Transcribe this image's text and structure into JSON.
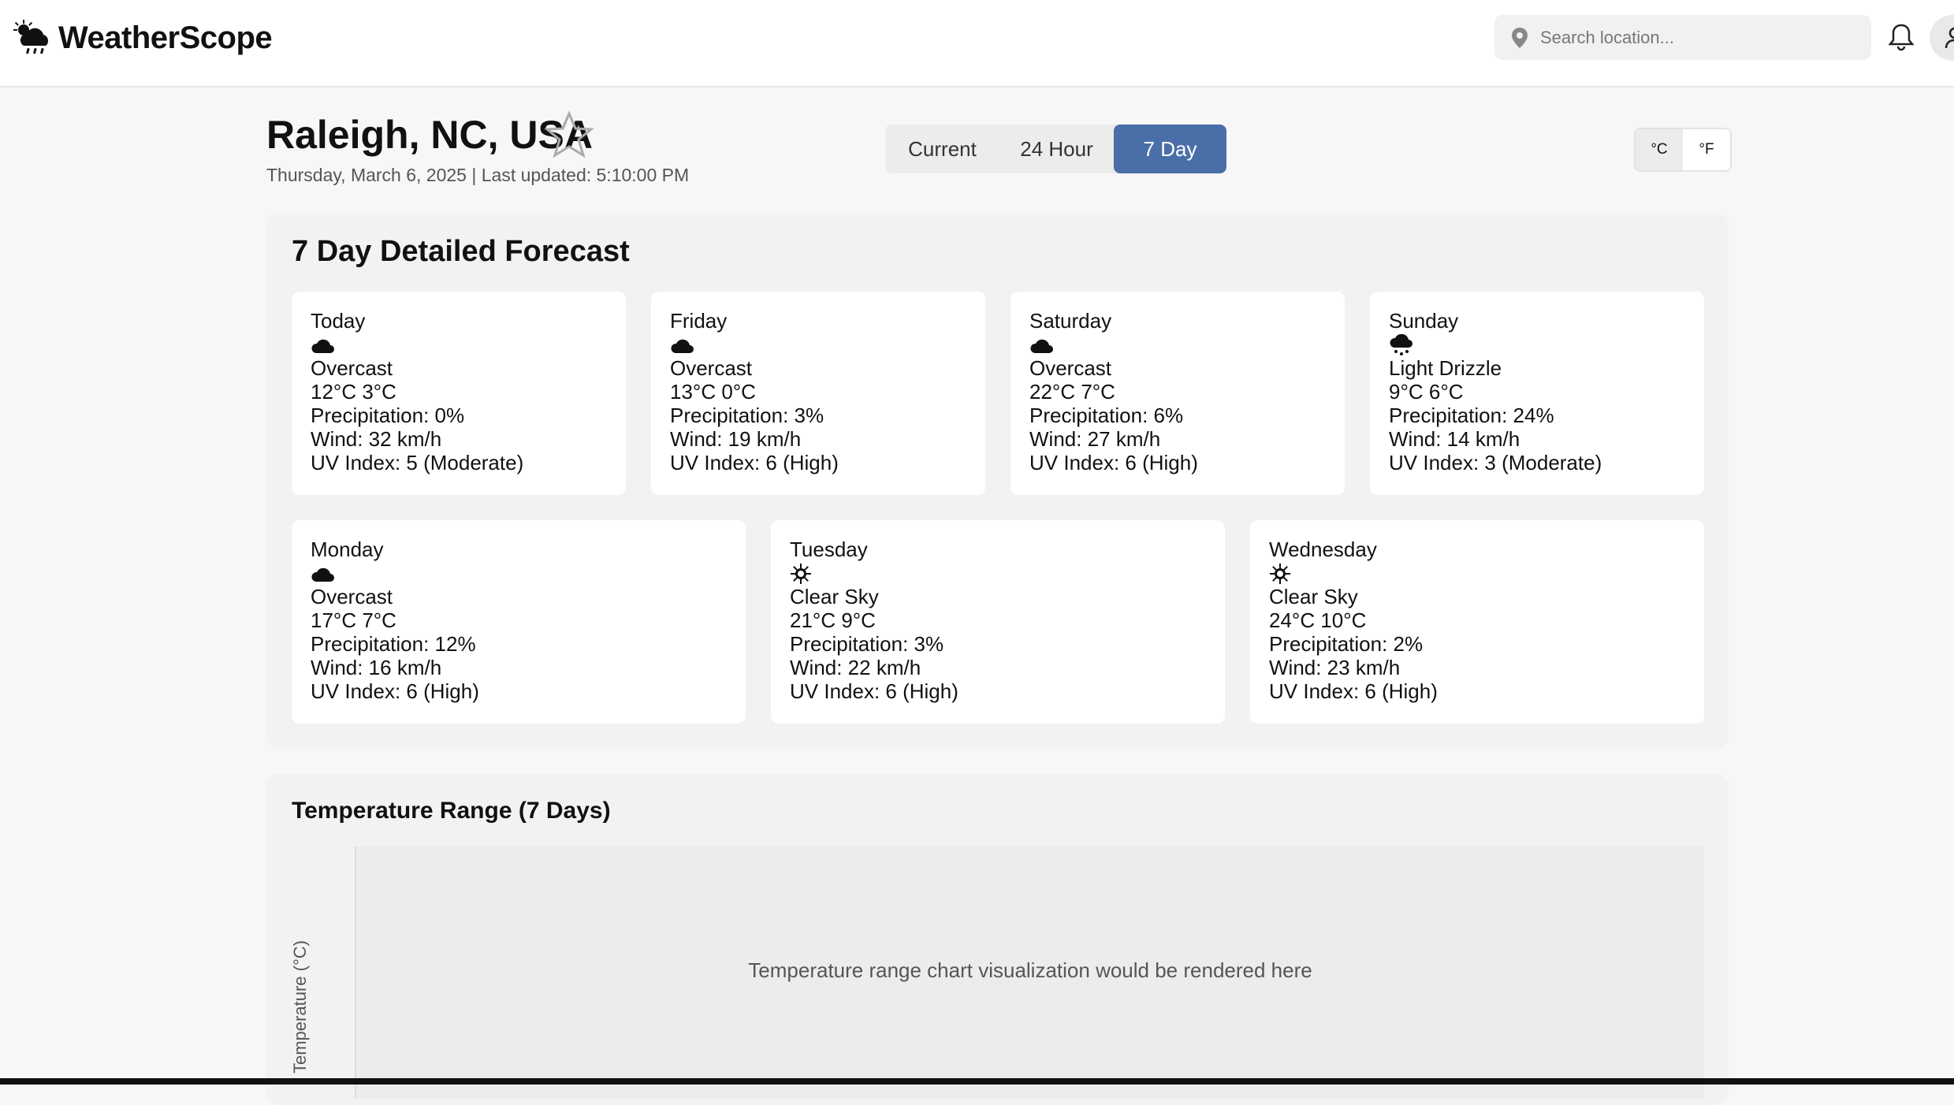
{
  "app": {
    "name": "WeatherScope"
  },
  "search": {
    "placeholder": "Search location..."
  },
  "location": {
    "name": "Raleigh, NC, USA",
    "subtitle": "Thursday, March 6, 2025 | Last updated: 5:10:00 PM"
  },
  "tabs": [
    {
      "label": "Current",
      "active": false
    },
    {
      "label": "24 Hour",
      "active": false
    },
    {
      "label": "7 Day",
      "active": true
    }
  ],
  "units": {
    "celsius": "°C",
    "fahrenheit": "°F",
    "selected": "°C"
  },
  "forecast": {
    "title": "7 Day Detailed Forecast",
    "days": [
      {
        "day": "Today",
        "icon": "cloud-icon",
        "condition": "Overcast",
        "temps": "12°C 3°C",
        "precip": "Precipitation: 0%",
        "wind": "Wind: 32 km/h",
        "uv": "UV Index: 5 (Moderate)"
      },
      {
        "day": "Friday",
        "icon": "cloud-icon",
        "condition": "Overcast",
        "temps": "13°C 0°C",
        "precip": "Precipitation: 3%",
        "wind": "Wind: 19 km/h",
        "uv": "UV Index: 6 (High)"
      },
      {
        "day": "Saturday",
        "icon": "cloud-icon",
        "condition": "Overcast",
        "temps": "22°C 7°C",
        "precip": "Precipitation: 6%",
        "wind": "Wind: 27 km/h",
        "uv": "UV Index: 6 (High)"
      },
      {
        "day": "Sunday",
        "icon": "drizzle-icon",
        "condition": "Light Drizzle",
        "temps": "9°C 6°C",
        "precip": "Precipitation: 24%",
        "wind": "Wind: 14 km/h",
        "uv": "UV Index: 3 (Moderate)"
      },
      {
        "day": "Monday",
        "icon": "cloud-icon",
        "condition": "Overcast",
        "temps": "17°C 7°C",
        "precip": "Precipitation: 12%",
        "wind": "Wind: 16 km/h",
        "uv": "UV Index: 6 (High)"
      },
      {
        "day": "Tuesday",
        "icon": "sun-icon",
        "condition": "Clear Sky",
        "temps": "21°C 9°C",
        "precip": "Precipitation: 3%",
        "wind": "Wind: 22 km/h",
        "uv": "UV Index: 6 (High)"
      },
      {
        "day": "Wednesday",
        "icon": "sun-icon",
        "condition": "Clear Sky",
        "temps": "24°C 10°C",
        "precip": "Precipitation: 2%",
        "wind": "Wind: 23 km/h",
        "uv": "UV Index: 6 (High)"
      }
    ]
  },
  "temp_chart": {
    "title": "Temperature Range (7 Days)",
    "placeholder": "Temperature range chart visualization would be rendered here",
    "ylabel": "Temperature (°C)"
  }
}
